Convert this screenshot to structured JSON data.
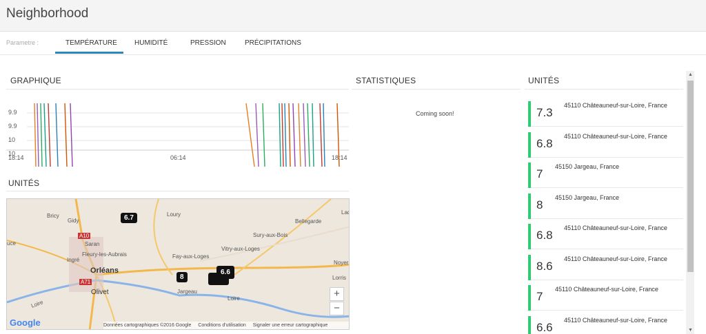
{
  "header": {
    "title": "Neighborhood"
  },
  "tabs": {
    "param_label": "Parametre :",
    "items": [
      {
        "label": "TEMPÉRATURE",
        "active": true
      },
      {
        "label": "HUMIDITÉ",
        "active": false
      },
      {
        "label": "PRESSION",
        "active": false
      },
      {
        "label": "PRÉCIPITATIONS",
        "active": false
      }
    ]
  },
  "graphique": {
    "title": "GRAPHIQUE"
  },
  "chart_data": {
    "type": "line",
    "y_tick_labels": [
      "9.9",
      "9.9",
      "10",
      "10"
    ],
    "x_tick_labels": [
      "18:14",
      "06:14",
      "18:14"
    ],
    "series_colors": [
      "#e67e22",
      "#9b59b6",
      "#27ae60",
      "#16a085",
      "#c0392b",
      "#2980b9",
      "#d35400",
      "#8e44ad"
    ],
    "grid": true
  },
  "map_section": {
    "title": "UNITÉS",
    "places": {
      "bricy": "Bricy",
      "gidy": "Gidy",
      "loury": "Loury",
      "bellegarde": "Bellegarde",
      "ladon": "Ladc",
      "saran": "Saran",
      "fleury": "Fleury-les-Aubrais",
      "ingre": "Ingré",
      "orleans": "Orléans",
      "olivet": "Olivet",
      "fay": "Fay-aux-Loges",
      "vitry": "Vitry-aux-Loges",
      "sury": "Sury-aux-Bois",
      "jargeau": "Jargeau",
      "noyers": "Noyers",
      "lorris": "Lorris",
      "loire1": "Loire",
      "loire2": "Loire",
      "luce": "uce",
      "a10": "A10",
      "a71": "A71"
    },
    "markers": [
      "6.7",
      "8",
      "6.6"
    ],
    "zoom_in": "+",
    "zoom_out": "−",
    "google": "Google",
    "footer": {
      "copyright": "Données cartographiques ©2016 Google",
      "terms": "Conditions d'utilisation",
      "report": "Signaler une erreur cartographique"
    }
  },
  "statistiques": {
    "title": "STATISTIQUES",
    "message": "Coming soon!"
  },
  "units": {
    "title": "UNITÉS",
    "items": [
      {
        "value": "7.3",
        "location": "45110 Châteauneuf-sur-Loire, France"
      },
      {
        "value": "6.8",
        "location": "45110 Châteauneuf-sur-Loire, France"
      },
      {
        "value": "7",
        "location": "45150 Jargeau, France"
      },
      {
        "value": "8",
        "location": "45150 Jargeau, France"
      },
      {
        "value": "6.8",
        "location": "45110 Châteauneuf-sur-Loire, France"
      },
      {
        "value": "8.6",
        "location": "45110 Châteauneuf-sur-Loire, France"
      },
      {
        "value": "7",
        "location": "45110 Châteauneuf-sur-Loire, France"
      },
      {
        "value": "6.6",
        "location": "45110 Châteauneuf-sur-Loire, France"
      }
    ],
    "accent_color": "#2ecc71"
  }
}
